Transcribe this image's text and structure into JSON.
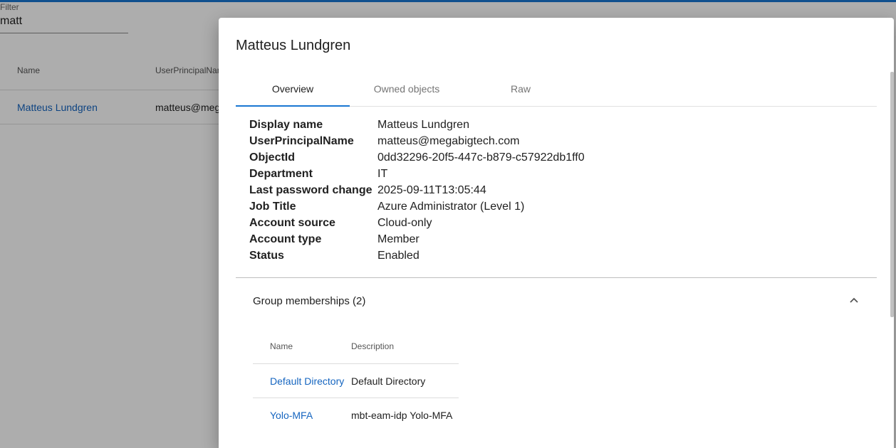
{
  "background": {
    "filter": {
      "label": "Filter",
      "value": "matt"
    },
    "table": {
      "columns": [
        "Name",
        "UserPrincipalName"
      ],
      "rows": [
        {
          "name": "Matteus Lundgren",
          "upn": "matteus@megabigtech.com"
        }
      ]
    }
  },
  "dialog": {
    "title": "Matteus Lundgren",
    "tabs": [
      "Overview",
      "Owned objects",
      "Raw"
    ],
    "active_tab": "Overview",
    "properties": [
      {
        "key": "Display name",
        "value": "Matteus Lundgren"
      },
      {
        "key": "UserPrincipalName",
        "value": "matteus@megabigtech.com"
      },
      {
        "key": "ObjectId",
        "value": "0dd32296-20f5-447c-b879-c57922db1ff0"
      },
      {
        "key": "Department",
        "value": "IT"
      },
      {
        "key": "Last password change",
        "value": "2025-09-11T13:05:44"
      },
      {
        "key": "Job Title",
        "value": "Azure Administrator (Level 1)"
      },
      {
        "key": "Account source",
        "value": "Cloud-only"
      },
      {
        "key": "Account type",
        "value": "Member"
      },
      {
        "key": "Status",
        "value": "Enabled"
      }
    ],
    "groups": {
      "title": "Group memberships (2)",
      "columns": [
        "Name",
        "Description"
      ],
      "rows": [
        {
          "name": "Default Directory",
          "description": "Default Directory"
        },
        {
          "name": "Yolo-MFA",
          "description": "mbt-eam-idp Yolo-MFA"
        }
      ]
    }
  },
  "colors": {
    "accent": "#1976d2",
    "link": "#1565c0",
    "overlay": "rgba(0,0,0,0.32)"
  },
  "icons": [
    "chevron-up-icon"
  ]
}
